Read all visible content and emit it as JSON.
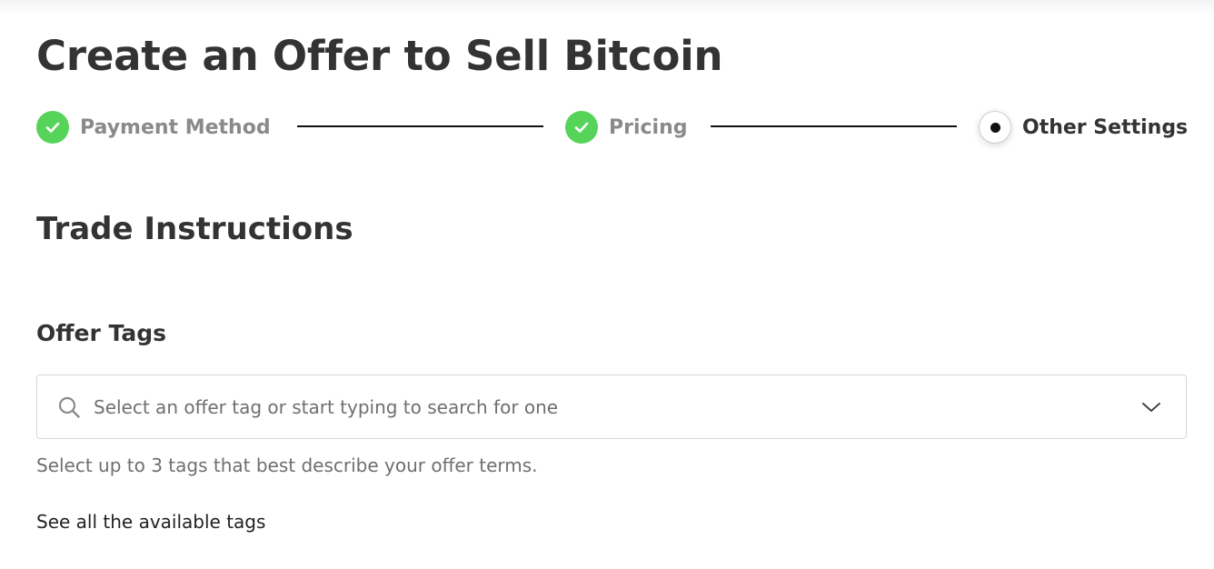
{
  "page": {
    "title": "Create an Offer to Sell Bitcoin"
  },
  "stepper": {
    "steps": [
      {
        "label": "Payment Method",
        "status": "complete",
        "icon": "check-icon"
      },
      {
        "label": "Pricing",
        "status": "complete",
        "icon": "check-icon"
      },
      {
        "label": "Other Settings",
        "status": "current",
        "icon": "current-step-dot"
      }
    ],
    "complete_color": "#56d45a"
  },
  "trade_instructions": {
    "title": "Trade Instructions"
  },
  "offer_tags": {
    "title": "Offer Tags",
    "search_icon": "search-icon",
    "placeholder": "Select an offer tag or start typing to search for one",
    "dropdown_icon": "chevron-down-icon",
    "help_text": "Select up to 3 tags that best describe your offer terms.",
    "see_all_link": "See all the available tags"
  }
}
